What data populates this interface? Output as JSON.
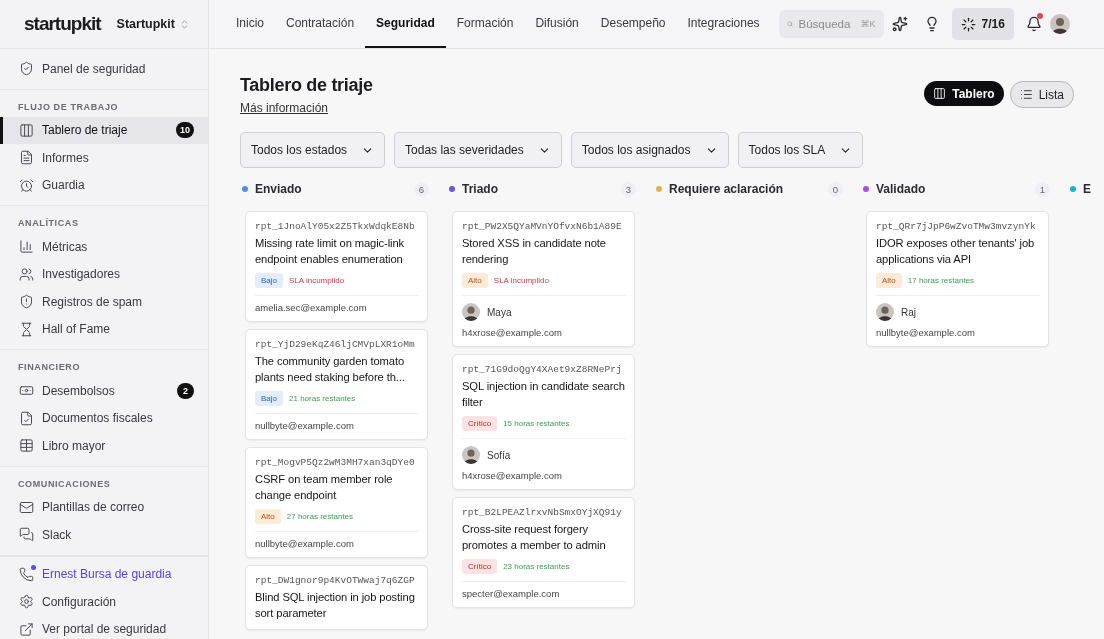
{
  "sidebar": {
    "logo": "startupkit",
    "workspace": "Startupkit",
    "top_items": [
      {
        "label": "Panel de seguridad",
        "selected": false
      }
    ],
    "sections": [
      {
        "title": "FLUJO DE TRABAJO",
        "items": [
          {
            "label": "Tablero de triaje",
            "selected": true,
            "badge": "10"
          },
          {
            "label": "Informes",
            "selected": false
          },
          {
            "label": "Guardia",
            "selected": false
          }
        ]
      },
      {
        "title": "ANALÍTICAS",
        "items": [
          {
            "label": "Métricas",
            "selected": false
          },
          {
            "label": "Investigadores",
            "selected": false
          },
          {
            "label": "Registros de spam",
            "selected": false
          },
          {
            "label": "Hall of Fame",
            "selected": false
          }
        ]
      },
      {
        "title": "FINANCIERO",
        "items": [
          {
            "label": "Desembolsos",
            "selected": false,
            "badge": "2"
          },
          {
            "label": "Documentos fiscales",
            "selected": false
          },
          {
            "label": "Libro mayor",
            "selected": false
          }
        ]
      },
      {
        "title": "COMUNICACIONES",
        "items": [
          {
            "label": "Plantillas de correo",
            "selected": false
          },
          {
            "label": "Slack",
            "selected": false
          }
        ]
      }
    ],
    "footer_items": [
      {
        "label": "Ernest Bursa de guardia",
        "highlight": true
      },
      {
        "label": "Configuración",
        "highlight": false
      },
      {
        "label": "Ver portal de seguridad",
        "highlight": false
      }
    ]
  },
  "nav": {
    "tabs": [
      {
        "label": "Inicio",
        "selected": false
      },
      {
        "label": "Contratación",
        "selected": false
      },
      {
        "label": "Seguridad",
        "selected": true
      },
      {
        "label": "Formación",
        "selected": false
      },
      {
        "label": "Difusión",
        "selected": false
      },
      {
        "label": "Desempeño",
        "selected": false
      },
      {
        "label": "Integraciones",
        "selected": false
      }
    ],
    "search": {
      "placeholder": "Búsqueda",
      "shortcut": "⌘K"
    },
    "progress": "7/16",
    "notifications_unread": true
  },
  "page": {
    "title": "Tablero de triaje",
    "link": "Más información",
    "views": [
      {
        "label": "Tablero",
        "selected": true
      },
      {
        "label": "Lista",
        "selected": false
      }
    ],
    "filters": [
      "Todos los estados",
      "Todas las severidades",
      "Todos los asignados",
      "Todos los SLA"
    ]
  },
  "columns": [
    {
      "name": "Enviado",
      "color": "#4a8fe7",
      "count": "6",
      "cards": [
        {
          "id": "rpt_1JnoAlY05x2Z5TkxWdqkE8Nb",
          "title": "Missing rate limit on magic-link endpoint enables enumeration",
          "severity": "Bajo",
          "kind": "low",
          "sla": "SLA incumplido",
          "breached": true,
          "email": "amelia.sec@example.com"
        },
        {
          "id": "rpt_YjD29eKqZ46ljCMVpLXR1oMm",
          "title": "The community garden tomato plants need staking before th...",
          "severity": "Bajo",
          "kind": "low",
          "sla": "21 horas restantes",
          "breached": false,
          "email": "nullbyte@example.com"
        },
        {
          "id": "rpt_MogvP5Qz2wM3MH7xan3qDYe0",
          "title": "CSRF on team member role change endpoint",
          "severity": "Alto",
          "kind": "high",
          "sla": "27 horas restantes",
          "breached": false,
          "email": "nullbyte@example.com"
        },
        {
          "id": "rpt_DW1gnor9p4KvOTWwaj7q6ZGP",
          "title": "Blind SQL injection in job posting sort parameter"
        }
      ]
    },
    {
      "name": "Triado",
      "color": "#5b5be6",
      "count": "3",
      "cards": [
        {
          "id": "rpt_PW2X5QYaMVnYOfvxN6b1A89E",
          "title": "Stored XSS in candidate note rendering",
          "severity": "Alto",
          "kind": "high",
          "sla": "SLA incumplido",
          "breached": true,
          "assignee": "Maya",
          "email": "h4xrose@example.com"
        },
        {
          "id": "rpt_71G9doQgY4XAet9xZ8RNePrj",
          "title": "SQL injection in candidate search filter",
          "severity": "Crítico",
          "kind": "critical",
          "sla": "15 horas restantes",
          "breached": false,
          "assignee": "Sofía",
          "email": "h4xrose@example.com"
        },
        {
          "id": "rpt_B2LPEAZlrxvNbSmxOYjXQ91y",
          "title": "Cross-site request forgery promotes a member to admin",
          "severity": "Crítico",
          "kind": "critical",
          "sla": "23 horas restantes",
          "breached": false,
          "email": "specter@example.com"
        }
      ]
    },
    {
      "name": "Requiere aclaración",
      "color": "#e0b050",
      "count": "0"
    },
    {
      "name": "Validado",
      "color": "#a64ee8",
      "count": "1",
      "cards": [
        {
          "id": "rpt_QRr7jJpP6wZvoTMw3mvzynYk",
          "title": "IDOR exposes other tenants' job applications via API",
          "severity": "Alto",
          "kind": "high",
          "sla": "17 horas restantes",
          "breached": false,
          "assignee": "Raj",
          "email": "nullbyte@example.com"
        }
      ]
    },
    {
      "name": "E",
      "color": "#17b3d0"
    }
  ]
}
